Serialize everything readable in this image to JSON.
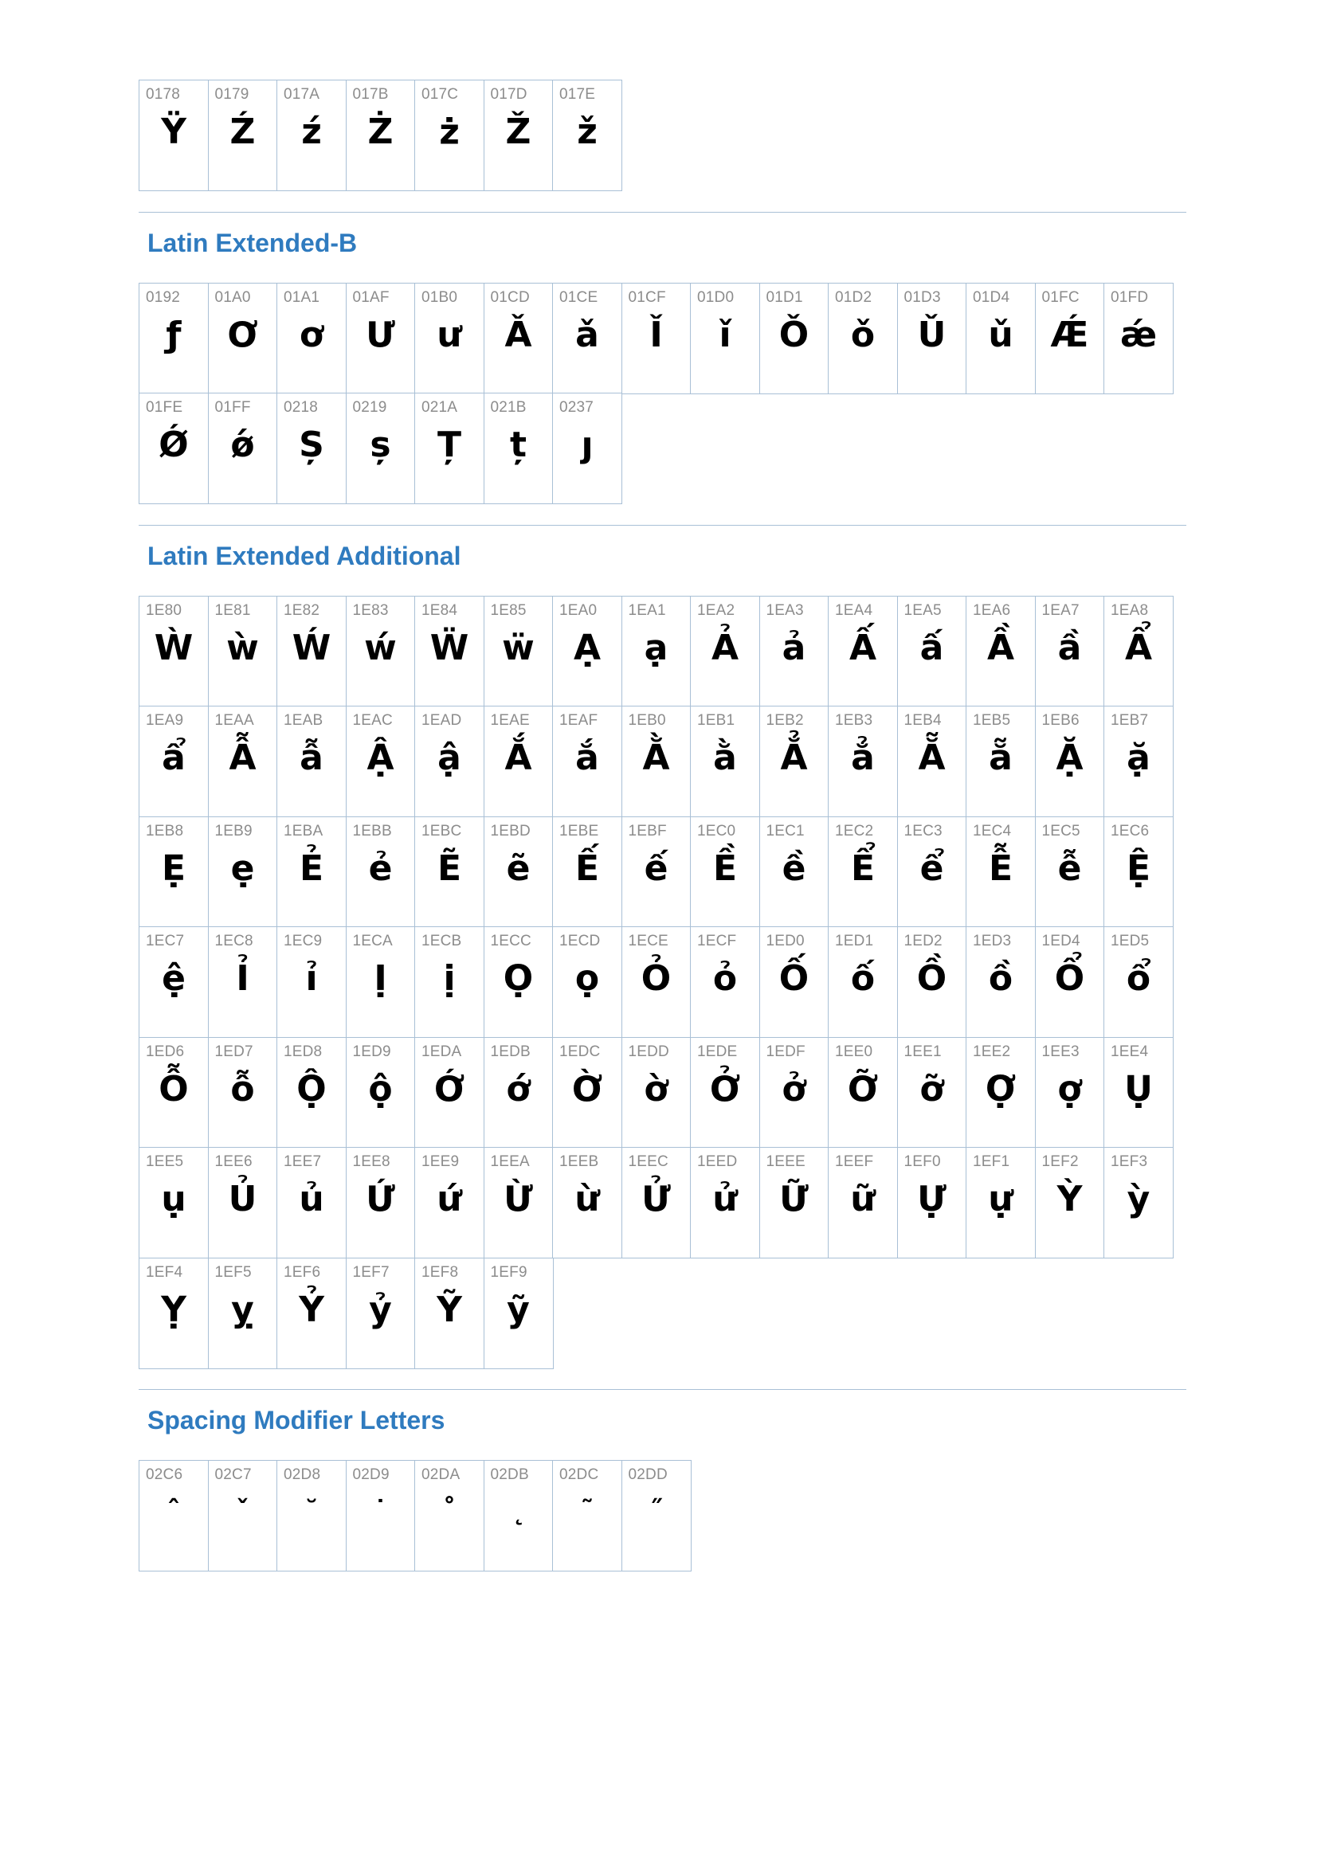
{
  "sections": [
    {
      "title": "",
      "cells": [
        {
          "code": "0178",
          "glyph": "Ÿ"
        },
        {
          "code": "0179",
          "glyph": "Ź"
        },
        {
          "code": "017A",
          "glyph": "ź"
        },
        {
          "code": "017B",
          "glyph": "Ż"
        },
        {
          "code": "017C",
          "glyph": "ż"
        },
        {
          "code": "017D",
          "glyph": "Ž"
        },
        {
          "code": "017E",
          "glyph": "ž"
        }
      ]
    },
    {
      "title": "Latin Extended-B",
      "cells": [
        {
          "code": "0192",
          "glyph": "ƒ"
        },
        {
          "code": "01A0",
          "glyph": "Ơ"
        },
        {
          "code": "01A1",
          "glyph": "ơ"
        },
        {
          "code": "01AF",
          "glyph": "Ư"
        },
        {
          "code": "01B0",
          "glyph": "ư"
        },
        {
          "code": "01CD",
          "glyph": "Ǎ"
        },
        {
          "code": "01CE",
          "glyph": "ǎ"
        },
        {
          "code": "01CF",
          "glyph": "Ǐ"
        },
        {
          "code": "01D0",
          "glyph": "ǐ"
        },
        {
          "code": "01D1",
          "glyph": "Ǒ"
        },
        {
          "code": "01D2",
          "glyph": "ǒ"
        },
        {
          "code": "01D3",
          "glyph": "Ǔ"
        },
        {
          "code": "01D4",
          "glyph": "ǔ"
        },
        {
          "code": "01FC",
          "glyph": "Ǽ"
        },
        {
          "code": "01FD",
          "glyph": "ǽ"
        },
        {
          "code": "01FE",
          "glyph": "Ǿ"
        },
        {
          "code": "01FF",
          "glyph": "ǿ"
        },
        {
          "code": "0218",
          "glyph": "Ș"
        },
        {
          "code": "0219",
          "glyph": "ș"
        },
        {
          "code": "021A",
          "glyph": "Ț"
        },
        {
          "code": "021B",
          "glyph": "ț"
        },
        {
          "code": "0237",
          "glyph": "ȷ"
        }
      ]
    },
    {
      "title": "Latin Extended Additional",
      "cells": [
        {
          "code": "1E80",
          "glyph": "Ẁ"
        },
        {
          "code": "1E81",
          "glyph": "ẁ"
        },
        {
          "code": "1E82",
          "glyph": "Ẃ"
        },
        {
          "code": "1E83",
          "glyph": "ẃ"
        },
        {
          "code": "1E84",
          "glyph": "Ẅ"
        },
        {
          "code": "1E85",
          "glyph": "ẅ"
        },
        {
          "code": "1EA0",
          "glyph": "Ạ"
        },
        {
          "code": "1EA1",
          "glyph": "ạ"
        },
        {
          "code": "1EA2",
          "glyph": "Ả"
        },
        {
          "code": "1EA3",
          "glyph": "ả"
        },
        {
          "code": "1EA4",
          "glyph": "Ấ"
        },
        {
          "code": "1EA5",
          "glyph": "ấ"
        },
        {
          "code": "1EA6",
          "glyph": "Ầ"
        },
        {
          "code": "1EA7",
          "glyph": "ầ"
        },
        {
          "code": "1EA8",
          "glyph": "Ẩ"
        },
        {
          "code": "1EA9",
          "glyph": "ẩ"
        },
        {
          "code": "1EAA",
          "glyph": "Ẫ"
        },
        {
          "code": "1EAB",
          "glyph": "ẫ"
        },
        {
          "code": "1EAC",
          "glyph": "Ậ"
        },
        {
          "code": "1EAD",
          "glyph": "ậ"
        },
        {
          "code": "1EAE",
          "glyph": "Ắ"
        },
        {
          "code": "1EAF",
          "glyph": "ắ"
        },
        {
          "code": "1EB0",
          "glyph": "Ằ"
        },
        {
          "code": "1EB1",
          "glyph": "ằ"
        },
        {
          "code": "1EB2",
          "glyph": "Ẳ"
        },
        {
          "code": "1EB3",
          "glyph": "ẳ"
        },
        {
          "code": "1EB4",
          "glyph": "Ẵ"
        },
        {
          "code": "1EB5",
          "glyph": "ẵ"
        },
        {
          "code": "1EB6",
          "glyph": "Ặ"
        },
        {
          "code": "1EB7",
          "glyph": "ặ"
        },
        {
          "code": "1EB8",
          "glyph": "Ẹ"
        },
        {
          "code": "1EB9",
          "glyph": "ẹ"
        },
        {
          "code": "1EBA",
          "glyph": "Ẻ"
        },
        {
          "code": "1EBB",
          "glyph": "ẻ"
        },
        {
          "code": "1EBC",
          "glyph": "Ẽ"
        },
        {
          "code": "1EBD",
          "glyph": "ẽ"
        },
        {
          "code": "1EBE",
          "glyph": "Ế"
        },
        {
          "code": "1EBF",
          "glyph": "ế"
        },
        {
          "code": "1EC0",
          "glyph": "Ề"
        },
        {
          "code": "1EC1",
          "glyph": "ề"
        },
        {
          "code": "1EC2",
          "glyph": "Ể"
        },
        {
          "code": "1EC3",
          "glyph": "ể"
        },
        {
          "code": "1EC4",
          "glyph": "Ễ"
        },
        {
          "code": "1EC5",
          "glyph": "ễ"
        },
        {
          "code": "1EC6",
          "glyph": "Ệ"
        },
        {
          "code": "1EC7",
          "glyph": "ệ"
        },
        {
          "code": "1EC8",
          "glyph": "Ỉ"
        },
        {
          "code": "1EC9",
          "glyph": "ỉ"
        },
        {
          "code": "1ECA",
          "glyph": "Ị"
        },
        {
          "code": "1ECB",
          "glyph": "ị"
        },
        {
          "code": "1ECC",
          "glyph": "Ọ"
        },
        {
          "code": "1ECD",
          "glyph": "ọ"
        },
        {
          "code": "1ECE",
          "glyph": "Ỏ"
        },
        {
          "code": "1ECF",
          "glyph": "ỏ"
        },
        {
          "code": "1ED0",
          "glyph": "Ố"
        },
        {
          "code": "1ED1",
          "glyph": "ố"
        },
        {
          "code": "1ED2",
          "glyph": "Ồ"
        },
        {
          "code": "1ED3",
          "glyph": "ồ"
        },
        {
          "code": "1ED4",
          "glyph": "Ổ"
        },
        {
          "code": "1ED5",
          "glyph": "ổ"
        },
        {
          "code": "1ED6",
          "glyph": "Ỗ"
        },
        {
          "code": "1ED7",
          "glyph": "ỗ"
        },
        {
          "code": "1ED8",
          "glyph": "Ộ"
        },
        {
          "code": "1ED9",
          "glyph": "ộ"
        },
        {
          "code": "1EDA",
          "glyph": "Ớ"
        },
        {
          "code": "1EDB",
          "glyph": "ớ"
        },
        {
          "code": "1EDC",
          "glyph": "Ờ"
        },
        {
          "code": "1EDD",
          "glyph": "ờ"
        },
        {
          "code": "1EDE",
          "glyph": "Ở"
        },
        {
          "code": "1EDF",
          "glyph": "ở"
        },
        {
          "code": "1EE0",
          "glyph": "Ỡ"
        },
        {
          "code": "1EE1",
          "glyph": "ỡ"
        },
        {
          "code": "1EE2",
          "glyph": "Ợ"
        },
        {
          "code": "1EE3",
          "glyph": "ợ"
        },
        {
          "code": "1EE4",
          "glyph": "Ụ"
        },
        {
          "code": "1EE5",
          "glyph": "ụ"
        },
        {
          "code": "1EE6",
          "glyph": "Ủ"
        },
        {
          "code": "1EE7",
          "glyph": "ủ"
        },
        {
          "code": "1EE8",
          "glyph": "Ứ"
        },
        {
          "code": "1EE9",
          "glyph": "ứ"
        },
        {
          "code": "1EEA",
          "glyph": "Ừ"
        },
        {
          "code": "1EEB",
          "glyph": "ừ"
        },
        {
          "code": "1EEC",
          "glyph": "Ử"
        },
        {
          "code": "1EED",
          "glyph": "ử"
        },
        {
          "code": "1EEE",
          "glyph": "Ữ"
        },
        {
          "code": "1EEF",
          "glyph": "ữ"
        },
        {
          "code": "1EF0",
          "glyph": "Ự"
        },
        {
          "code": "1EF1",
          "glyph": "ự"
        },
        {
          "code": "1EF2",
          "glyph": "Ỳ"
        },
        {
          "code": "1EF3",
          "glyph": "ỳ"
        },
        {
          "code": "1EF4",
          "glyph": "Ỵ"
        },
        {
          "code": "1EF5",
          "glyph": "ỵ"
        },
        {
          "code": "1EF6",
          "glyph": "Ỷ"
        },
        {
          "code": "1EF7",
          "glyph": "ỷ"
        },
        {
          "code": "1EF8",
          "glyph": "Ỹ"
        },
        {
          "code": "1EF9",
          "glyph": "ỹ"
        }
      ]
    },
    {
      "title": "Spacing Modifier Letters",
      "cells": [
        {
          "code": "02C6",
          "glyph": "ˆ"
        },
        {
          "code": "02C7",
          "glyph": "ˇ"
        },
        {
          "code": "02D8",
          "glyph": "˘"
        },
        {
          "code": "02D9",
          "glyph": "˙"
        },
        {
          "code": "02DA",
          "glyph": "˚"
        },
        {
          "code": "02DB",
          "glyph": "˛"
        },
        {
          "code": "02DC",
          "glyph": "˜"
        },
        {
          "code": "02DD",
          "glyph": "˝"
        }
      ]
    }
  ]
}
